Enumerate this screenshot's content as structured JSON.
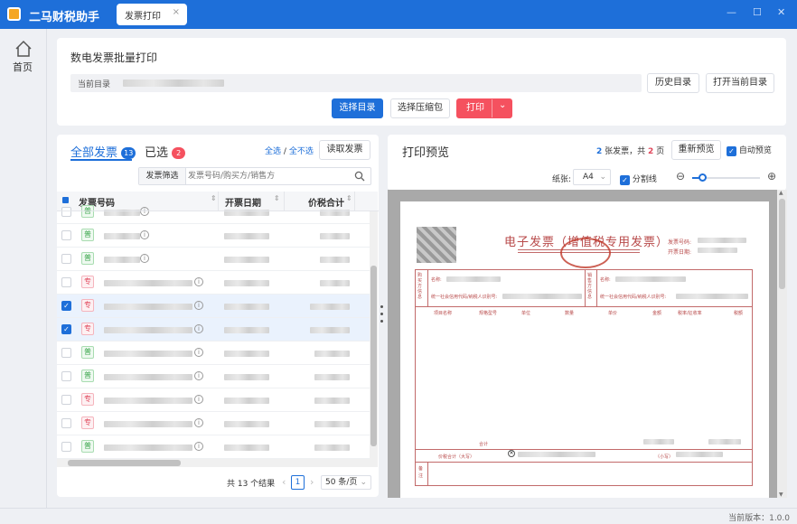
{
  "app": {
    "title": "二马财税助手",
    "tab_label": "发票打印",
    "tab_close": "×"
  },
  "window_controls": {
    "min": "—",
    "max": "☐",
    "close": "✕"
  },
  "sidebar": {
    "home_label": "首页"
  },
  "header": {
    "title": "数电发票批量打印",
    "dir_label": "当前目录",
    "history_button": "历史目录",
    "open_dir_button": "打开当前目录",
    "select_dir_button": "选择目录",
    "select_zip_button": "选择压缩包",
    "print_button": "打印",
    "print_dropdown": "⌄"
  },
  "list_panel": {
    "tab_all": "全部发票",
    "tab_all_count": "13",
    "tab_selected": "已选",
    "tab_selected_count": "2",
    "select_all": "全选",
    "separator": "/",
    "select_none": "全不选",
    "read_button": "读取发票",
    "filter_label": "发票筛选",
    "filter_placeholder": "发票号码/购买方/销售方",
    "columns": [
      "发票号码",
      "开票日期",
      "价税合计"
    ],
    "rows": [
      {
        "type": "普",
        "checked": false
      },
      {
        "type": "普",
        "checked": false
      },
      {
        "type": "普",
        "checked": false
      },
      {
        "type": "专",
        "checked": false
      },
      {
        "type": "专",
        "checked": true
      },
      {
        "type": "专",
        "checked": true
      },
      {
        "type": "普",
        "checked": false
      },
      {
        "type": "普",
        "checked": false
      },
      {
        "type": "专",
        "checked": false
      },
      {
        "type": "专",
        "checked": false
      },
      {
        "type": "普",
        "checked": false
      }
    ],
    "total_text": "共 13 个结果",
    "current_page": "1",
    "page_size": "50 条/页",
    "prev": "‹",
    "next": "›"
  },
  "preview_panel": {
    "title": "打印预览",
    "invoice_count": "2",
    "summary_mid": "张发票，共",
    "page_count": "2",
    "summary_end": "页",
    "refresh_button": "重新预览",
    "auto_preview_label": "自动预览",
    "paper_label": "纸张:",
    "paper_value": "A4",
    "divider_label": "分割线",
    "zoom_out": "⊖",
    "zoom_in": "⊕",
    "zoom_level": 0.15
  },
  "invoice": {
    "title": "电子发票（增值税专用发票）",
    "invoice_no_label": "发票号码:",
    "issue_date_label": "开票日期:",
    "buyer_side": "购买方信息",
    "seller_side": "销售方信息",
    "name_label": "名称:",
    "tax_id_label": "统一社会信用代码/纳税人识别号:",
    "col_headers": [
      "项目名称",
      "规格型号",
      "单位",
      "数量",
      "单价",
      "金额",
      "税率/征收率",
      "税额"
    ],
    "total_label": "合计",
    "grand_total_label": "价税合计（大写）",
    "small_label": "（小写）",
    "remark_label": "备注"
  },
  "status": {
    "version": "当前版本：1.0.0"
  }
}
